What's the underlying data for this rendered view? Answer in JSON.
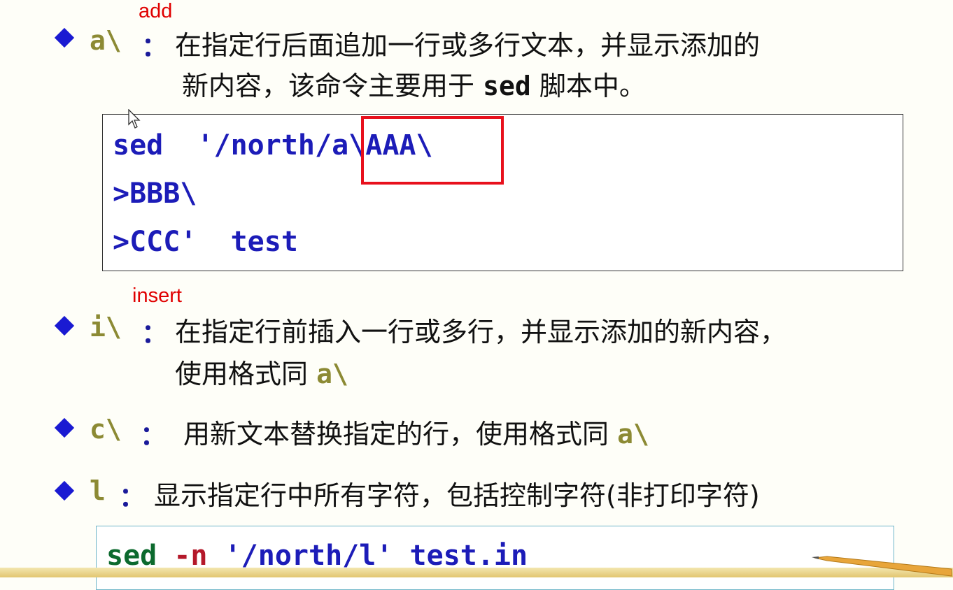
{
  "notes": {
    "add": "add",
    "insert": "insert"
  },
  "items": [
    {
      "cmd": "a\\",
      "sep": "：",
      "line1": "在指定行后面追加一行或多行文本，并显示添加的",
      "line2_pre": "新内容，该命令主要用于 ",
      "line2_mono": "sed",
      "line2_post": " 脚本中。"
    },
    {
      "cmd": "i\\",
      "sep": "：",
      "line1": "在指定行前插入一行或多行，并显示添加的新内容，",
      "line2_pre": "使用格式同 ",
      "line2_cmd": "a\\"
    },
    {
      "cmd": "c\\",
      "sep": " ：",
      "line1_pre": "用新文本替换指定的行，使用格式同 ",
      "line1_cmd": "a\\"
    },
    {
      "cmd": "l",
      "sep": "：",
      "line1": "显示指定行中所有字符，包括控制字符(非打印字符)"
    }
  ],
  "code_block_1": {
    "lines": [
      "sed  '/north/a\\AAA\\",
      ">BBB\\",
      ">CCC'  test"
    ]
  },
  "code_block_2": {
    "seg1": "sed ",
    "seg2": "-n ",
    "seg3": "'/north/l'",
    "seg4": " test.in"
  },
  "colors": {
    "bullet": "#1a1ad2",
    "command": "#8c8a34",
    "code": "#1c1cb8",
    "annotation": "#e00000",
    "highlight": "#e8101c"
  },
  "icons": [
    "diamond-bullet-icon",
    "mouse-cursor-icon",
    "pencil-icon"
  ]
}
